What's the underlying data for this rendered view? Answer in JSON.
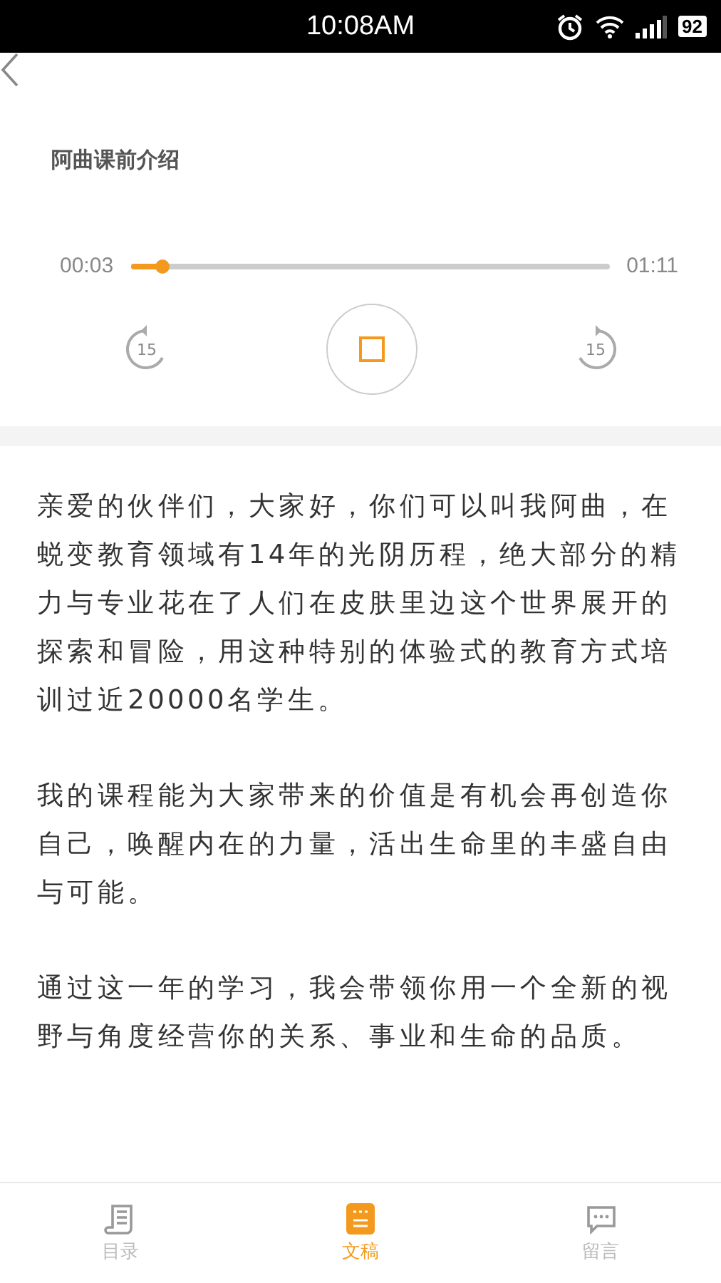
{
  "status_bar": {
    "time": "10:08AM",
    "battery": "92"
  },
  "player": {
    "title": "阿曲课前介绍",
    "elapsed": "00:03",
    "duration": "01:11",
    "rewind_label": "15",
    "forward_label": "15",
    "playing": true
  },
  "article": {
    "paragraphs": [
      "亲爱的伙伴们，大家好，你们可以叫我阿曲，在蜕变教育领域有14年的光阴历程，绝大部分的精力与专业花在了人们在皮肤里边这个世界展开的探索和冒险，用这种特别的体验式的教育方式培训过近20000名学生。",
      "我的课程能为大家带来的价值是有机会再创造你自己，唤醒内在的力量，活出生命里的丰盛自由与可能。",
      "通过这一年的学习，我会带领你用一个全新的视野与角度经营你的关系、事业和生命的品质。"
    ]
  },
  "tabs": [
    {
      "label": "目录",
      "kind": "contents",
      "selected": false
    },
    {
      "label": "文稿",
      "kind": "transcript",
      "selected": true
    },
    {
      "label": "留言",
      "kind": "comments",
      "selected": false
    }
  ]
}
